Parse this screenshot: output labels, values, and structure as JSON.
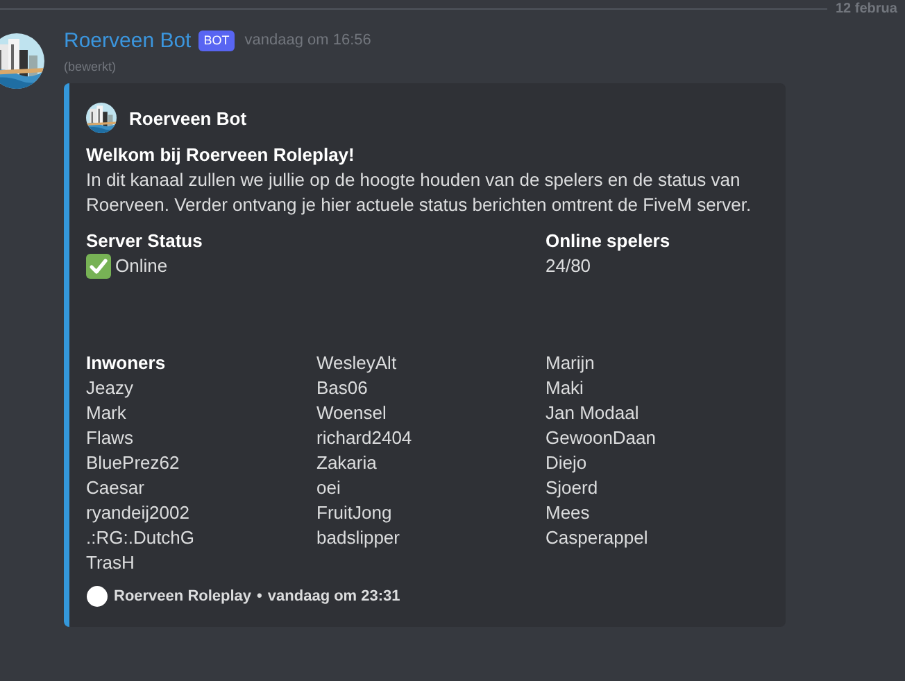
{
  "divider": {
    "date": "12 februa"
  },
  "message": {
    "author": "Roerveen Bot",
    "badge": "BOT",
    "timestamp": "vandaag om 16:56",
    "edited": "(bewerkt)",
    "embed": {
      "author": "Roerveen Bot",
      "title": "Welkom bij Roerveen Roleplay!",
      "description": "In dit kanaal zullen we jullie op de hoogte houden van de spelers en de status van Roerveen. Verder ontvang je hier actuele status berichten omtrent de FiveM server.",
      "fields": [
        {
          "kind": "titled",
          "name": "Server Status",
          "check": true,
          "lines": [
            "Online"
          ]
        },
        {
          "kind": "blank"
        },
        {
          "kind": "titled",
          "name": "Online spelers",
          "lines": [
            "24/80"
          ]
        },
        {
          "kind": "blank"
        },
        {
          "kind": "blank"
        },
        {
          "kind": "blank"
        },
        {
          "kind": "titled",
          "name": "Inwoners",
          "lines": [
            "Jeazy",
            "Mark",
            "Flaws",
            "BluePrez62",
            "Caesar",
            "ryandeij2002",
            ".:RG:.DutchG",
            "TrasH"
          ]
        },
        {
          "kind": "untitled",
          "lines": [
            "WesleyAlt",
            "Bas06",
            "Woensel",
            "richard2404",
            "Zakaria",
            "oei",
            "FruitJong",
            "badslipper"
          ]
        },
        {
          "kind": "untitled",
          "lines": [
            "Marijn",
            "Maki",
            "Jan Modaal",
            "GewoonDaan",
            "Diejo",
            "Sjoerd",
            "Mees",
            "Casperappel"
          ]
        }
      ],
      "footer": {
        "text": "Roerveen Roleplay",
        "separator": "•",
        "timestamp": "vandaag om 23:31"
      }
    }
  }
}
